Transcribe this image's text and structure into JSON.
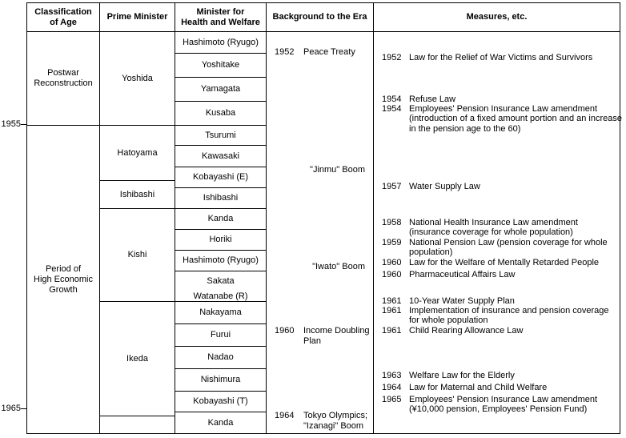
{
  "year_axis": {
    "ticks": [
      {
        "label": "1955"
      },
      {
        "label": "1965"
      }
    ]
  },
  "table": {
    "headers": {
      "classification": "Classification\nof Age",
      "classification_line1": "Classification",
      "classification_line2": "of Age",
      "prime_minister": "Prime Minister",
      "minister_line1": "Minister for",
      "minister_line2": "Health and Welfare",
      "background": "Background to the Era",
      "measures": "Measures, etc."
    },
    "classification": [
      {
        "line1": "Postwar",
        "line2": "Reconstruction"
      },
      {
        "line1": "Period of",
        "line2": "High Economic",
        "line3": "Growth"
      }
    ],
    "prime_ministers": [
      {
        "name": "Yoshida"
      },
      {
        "name": "Hatoyama"
      },
      {
        "name": "Ishibashi"
      },
      {
        "name": "Kishi"
      },
      {
        "name": "Ikeda"
      },
      {
        "name": ""
      }
    ],
    "ministers": [
      {
        "name": "Hashimoto (Ryugo)"
      },
      {
        "name": "Yoshitake"
      },
      {
        "name": "Yamagata"
      },
      {
        "name": "Kusaba"
      },
      {
        "name": "Tsurumi"
      },
      {
        "name": "Kawasaki"
      },
      {
        "name": "Kobayashi (E)"
      },
      {
        "name": "Ishibashi"
      },
      {
        "name": "Kanda"
      },
      {
        "name": "Horiki"
      },
      {
        "name": "Hashimoto (Ryugo)"
      },
      {
        "name": "Sakata"
      },
      {
        "name": "Watanabe (R)"
      },
      {
        "name": "Nakayama"
      },
      {
        "name": "Furui"
      },
      {
        "name": "Nadao"
      },
      {
        "name": "Nishimura"
      },
      {
        "name": "Kobayashi (T)"
      },
      {
        "name": "Kanda"
      }
    ],
    "background_entries": [
      {
        "year": "1952",
        "text": "Peace Treaty",
        "cont": ""
      },
      {
        "year": "",
        "text": "\"Jinmu\" Boom",
        "cont": ""
      },
      {
        "year": "",
        "text": "\"Iwato\" Boom",
        "cont": ""
      },
      {
        "year": "1960",
        "text": "Income Doubling",
        "cont": "Plan"
      },
      {
        "year": "1964",
        "text": "Tokyo Olympics;",
        "cont": "\"Izanagi\" Boom"
      }
    ],
    "measures_entries": [
      {
        "year": "1952",
        "text": "Law for the Relief of War Victims and Survivors",
        "cont": []
      },
      {
        "year": "1954",
        "text": "Refuse Law",
        "cont": []
      },
      {
        "year": "1954",
        "text": "Employees' Pension Insurance Law amendment",
        "cont": [
          "(introduction of a fixed amount portion and an increase",
          "in the pension age to the 60)"
        ]
      },
      {
        "year": "1957",
        "text": "Water Supply Law",
        "cont": []
      },
      {
        "year": "1958",
        "text": "National Health Insurance Law amendment",
        "cont": [
          "(insurance coverage for whole population)"
        ]
      },
      {
        "year": "1959",
        "text": "National Pension Law (pension coverage for whole",
        "cont": [
          "population)"
        ]
      },
      {
        "year": "1960",
        "text": "Law for the Welfare of Mentally Retarded People",
        "cont": []
      },
      {
        "year": "1960",
        "text": "Pharmaceutical Affairs Law",
        "cont": []
      },
      {
        "year": "1961",
        "text": "10-Year Water Supply Plan",
        "cont": []
      },
      {
        "year": "1961",
        "text": "Implementation of insurance and pension coverage",
        "cont": [
          "for whole population"
        ]
      },
      {
        "year": "1961",
        "text": "Child Rearing Allowance Law",
        "cont": []
      },
      {
        "year": "1963",
        "text": "Welfare Law for the Elderly",
        "cont": []
      },
      {
        "year": "1964",
        "text": "Law for Maternal and Child Welfare",
        "cont": []
      },
      {
        "year": "1965",
        "text": "Employees' Pension Insurance Law amendment",
        "cont": [
          "(¥10,000 pension, Employees' Pension Fund)"
        ]
      }
    ]
  },
  "colors": {
    "border": "#000000",
    "background": "#ffffff",
    "text": "#000000"
  }
}
